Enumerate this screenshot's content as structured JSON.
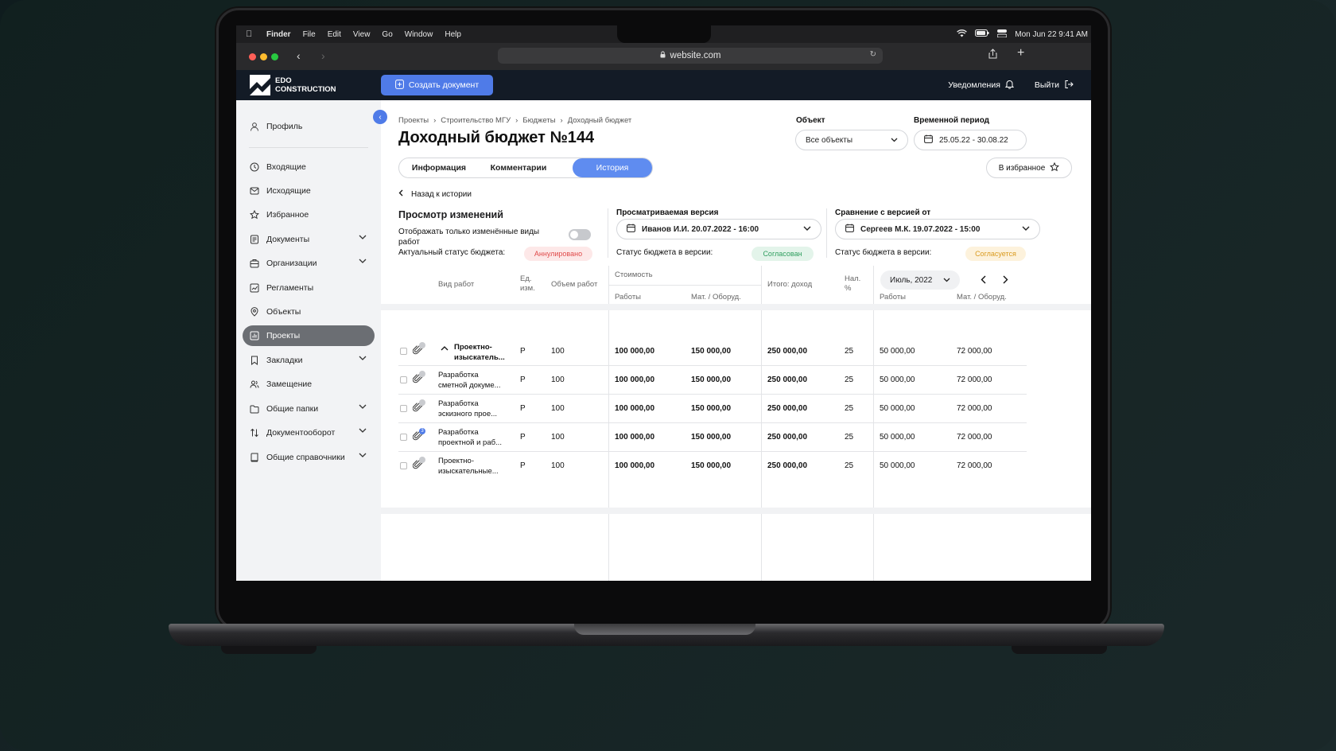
{
  "menubar": {
    "items": [
      "Finder",
      "File",
      "Edit",
      "View",
      "Go",
      "Window",
      "Help"
    ],
    "clock": "Mon Jun 22  9:41 AM"
  },
  "browser": {
    "url": "website.com"
  },
  "topnav": {
    "logo_line1": "EDO",
    "logo_line2": "CONSTRUCTION",
    "create_button": "Создать документ",
    "notifications": "Уведомления",
    "logout": "Выйти"
  },
  "sidebar": {
    "profile": "Профиль",
    "items": [
      {
        "label": "Входящие",
        "icon": "clock-icon",
        "chevron": false
      },
      {
        "label": "Исходящие",
        "icon": "mail-icon",
        "chevron": false
      },
      {
        "label": "Избранное",
        "icon": "star-icon",
        "chevron": false
      },
      {
        "label": "Документы",
        "icon": "document-icon",
        "chevron": true
      },
      {
        "label": "Организации",
        "icon": "organization-icon",
        "chevron": true
      },
      {
        "label": "Регламенты",
        "icon": "chart-icon",
        "chevron": false
      },
      {
        "label": "Объекты",
        "icon": "location-icon",
        "chevron": false
      },
      {
        "label": "Проекты",
        "icon": "projects-icon",
        "chevron": false,
        "active": true
      },
      {
        "label": "Закладки",
        "icon": "bookmark-icon",
        "chevron": true
      },
      {
        "label": "Замещение",
        "icon": "users-icon",
        "chevron": false
      },
      {
        "label": "Общие папки",
        "icon": "folder-icon",
        "chevron": true
      },
      {
        "label": "Документооборот",
        "icon": "swap-icon",
        "chevron": true
      },
      {
        "label": "Общие справочники",
        "icon": "book-icon",
        "chevron": true
      }
    ]
  },
  "breadcrumb": [
    "Проекты",
    "Строительство МГУ",
    "Бюджеты",
    "Доходный бюджет"
  ],
  "page_title": "Доходный бюджет №144",
  "filters": {
    "object_label": "Объект",
    "object_value": "Все объекты",
    "period_label": "Временной период",
    "period_value": "25.05.22 - 30.08.22"
  },
  "tabs": [
    {
      "label": "Информация",
      "active": false
    },
    {
      "label": "Комментарии",
      "active": false
    },
    {
      "label": "История",
      "active": true
    }
  ],
  "favorite_button": "В избранное",
  "back_link": "Назад к истории",
  "changes": {
    "title": "Просмотр изменений",
    "toggle_label": "Отображать только изменённые виды работ",
    "toggle_on": false,
    "actual_status_label": "Актуальный статус бюджета:",
    "actual_status": "Аннулировано",
    "actual_status_color": "#e04a4a"
  },
  "viewed_version": {
    "label": "Просматриваемая версия",
    "value": "Иванов И.И. 20.07.2022 - 16:00",
    "status_label": "Статус бюджета в версии:",
    "status": "Согласован",
    "status_color": "#2e9e5e"
  },
  "compare_version": {
    "label": "Сравнение с версией от",
    "value": "Сергеев М.К. 19.07.2022 - 15:00",
    "status_label": "Статус бюджета в версии:",
    "status": "Согласуется",
    "status_color": "#d99a1e"
  },
  "table": {
    "headers": {
      "work_type": "Вид работ",
      "unit": "Ед. изм.",
      "volume": "Объем работ",
      "cost": "Стоимость",
      "works": "Работы",
      "materials": "Мат. / Оборуд.",
      "total": "Итого: доход",
      "tax": "Нал. %",
      "month": "Июль, 2022",
      "works2": "Работы",
      "materials2": "Мат. / Оборуд."
    },
    "rows": [
      {
        "name": "Проектно- изыскатель...",
        "group": true,
        "unit": "Р",
        "volume": "100",
        "works": "100 000,00",
        "materials": "150 000,00",
        "total": "250 000,00",
        "tax": "25",
        "m_works": "50 000,00",
        "m_materials": "72 000,00",
        "badge": ""
      },
      {
        "name": "Разработка сметной докуме...",
        "group": false,
        "unit": "Р",
        "volume": "100",
        "works": "100 000,00",
        "materials": "150 000,00",
        "total": "250 000,00",
        "tax": "25",
        "m_works": "50 000,00",
        "m_materials": "72 000,00",
        "badge": ""
      },
      {
        "name": "Разработка эскизного прое...",
        "group": false,
        "unit": "Р",
        "volume": "100",
        "works": "100 000,00",
        "materials": "150 000,00",
        "total": "250 000,00",
        "tax": "25",
        "m_works": "50 000,00",
        "m_materials": "72 000,00",
        "badge": ""
      },
      {
        "name": "Разработка проектной и раб...",
        "group": false,
        "unit": "Р",
        "volume": "100",
        "works": "100 000,00",
        "materials": "150 000,00",
        "total": "250 000,00",
        "tax": "25",
        "m_works": "50 000,00",
        "m_materials": "72 000,00",
        "badge": "3"
      },
      {
        "name": "Проектно- изыскательные...",
        "group": false,
        "unit": "Р",
        "volume": "100",
        "works": "100 000,00",
        "materials": "150 000,00",
        "total": "250 000,00",
        "tax": "25",
        "m_works": "50 000,00",
        "m_materials": "72 000,00",
        "badge": ""
      }
    ]
  },
  "colors": {
    "accent": "#4f7be8",
    "topnav": "#131b26",
    "sidebar": "#f2f3f5"
  }
}
